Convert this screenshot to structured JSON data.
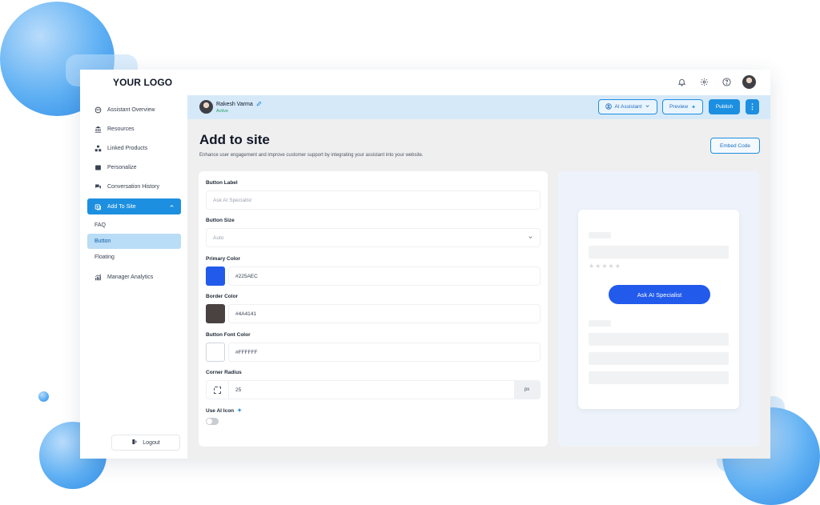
{
  "app": {
    "logo_text": "YOUR LOGO"
  },
  "topbar": {
    "icons": [
      "bell-icon",
      "gear-icon",
      "help-icon",
      "avatar"
    ]
  },
  "sidebar": {
    "items": [
      {
        "label": "Assistant Overview",
        "icon": "assistant-icon"
      },
      {
        "label": "Resources",
        "icon": "resources-icon"
      },
      {
        "label": "Linked Products",
        "icon": "linked-products-icon"
      },
      {
        "label": "Personalize",
        "icon": "personalize-icon"
      },
      {
        "label": "Conversation History",
        "icon": "conversation-icon"
      },
      {
        "label": "Add To Site",
        "icon": "add-to-site-icon",
        "active": true
      },
      {
        "label": "Manager Analytics",
        "icon": "analytics-icon"
      }
    ],
    "sub_items": [
      {
        "label": "FAQ"
      },
      {
        "label": "Button",
        "active": true
      },
      {
        "label": "Floating"
      }
    ],
    "logout_label": "Logout"
  },
  "header": {
    "user_name": "Rakesh Varma",
    "user_status": "Active",
    "assistant_label": "AI Assistant",
    "preview_label": "Preview",
    "publish_label": "Publish",
    "more_label": "⋮"
  },
  "main": {
    "title": "Add to site",
    "subtitle": "Enhance user engagement and improve customer support by integrating your assistant into your website.",
    "embed_label": "Embed Code"
  },
  "form": {
    "button_label": {
      "label": "Button Label",
      "placeholder": "Ask AI Specialist"
    },
    "button_size": {
      "label": "Button Size",
      "value": "Auto"
    },
    "primary_color": {
      "label": "Primary Color",
      "value": "#225AEC"
    },
    "border_color": {
      "label": "Border Color",
      "value": "#4A4141"
    },
    "font_color": {
      "label": "Button Font Color",
      "value": "#FFFFFF"
    },
    "corner_radius": {
      "label": "Corner Radius",
      "value": "25",
      "unit": "px"
    },
    "ai_icon": {
      "label": "Use AI Icon",
      "enabled": false
    }
  },
  "preview": {
    "button_text": "Ask AI Specialist",
    "stars": "★★★★★"
  }
}
